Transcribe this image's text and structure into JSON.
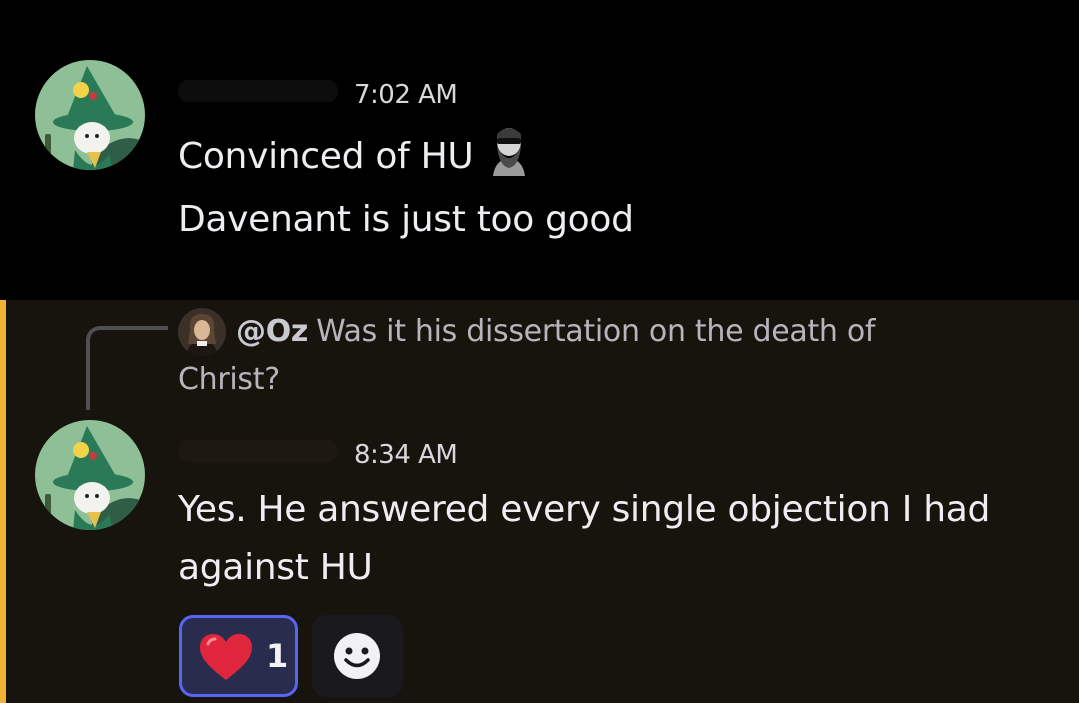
{
  "messages": [
    {
      "author_avatar": "snufkin-avatar",
      "timestamp": "7:02 AM",
      "lines": [
        "Convinced of HU",
        "Davenant is just too good"
      ],
      "inline_emoji": "bearded-man-sunglasses-emoji"
    },
    {
      "author_avatar": "snufkin-avatar",
      "reply_to": {
        "avatar": "portrait-avatar",
        "mention": "@Oz",
        "text_line1": "Was it his dissertation on the death of",
        "text_line2": "Christ?"
      },
      "timestamp": "8:34 AM",
      "lines": [
        "Yes. He answered every single objection I had",
        "against HU"
      ],
      "reactions": [
        {
          "emoji": "heart-emoji",
          "count": "1",
          "selected": true
        }
      ],
      "add_reaction_icon": "smiley-icon"
    }
  ],
  "colors": {
    "mention_highlight_bar": "#f0b232",
    "mention_background": "#17130d",
    "reaction_selected_border": "#5865f2",
    "reaction_selected_bg": "#2a2c4e"
  }
}
